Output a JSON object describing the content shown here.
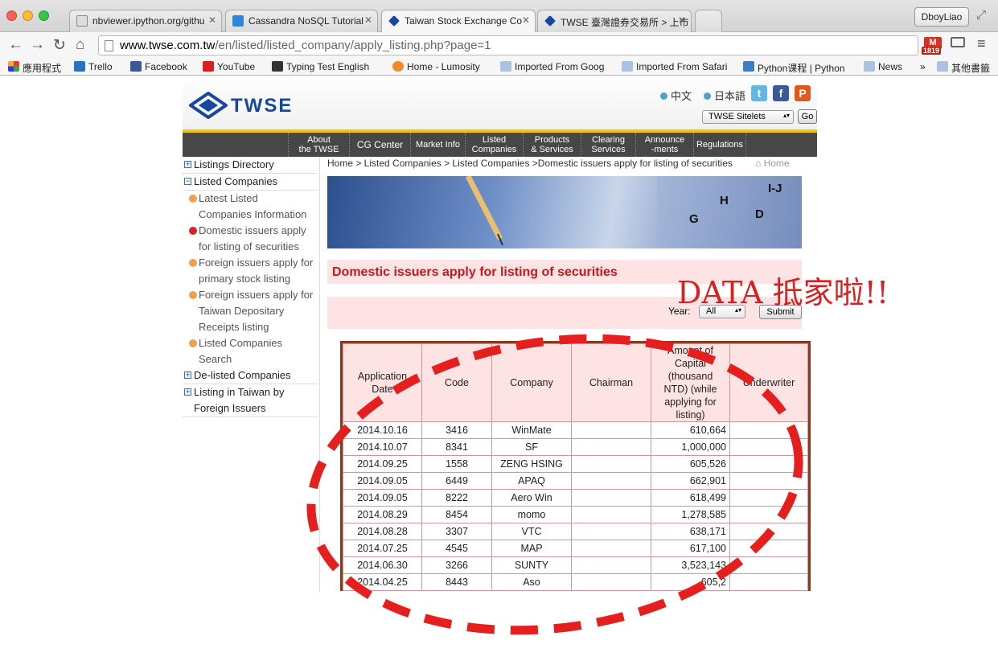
{
  "browser": {
    "tabs": [
      {
        "label": "nbviewer.ipython.org/githu"
      },
      {
        "label": "Cassandra NoSQL Tutorial"
      },
      {
        "label": "Taiwan Stock Exchange Co"
      },
      {
        "label": "TWSE 臺灣證券交易所 > 上市"
      }
    ],
    "user": "DboyLiao",
    "url_host": "www.twse.com.tw",
    "url_path": "/en/listed/listed_company/apply_listing.php?page=1",
    "mail_count": "1819",
    "bookmarks": [
      "應用程式",
      "Trello",
      "Facebook",
      "YouTube",
      "Typing Test English",
      "Home - Lumosity",
      "Imported From Goog",
      "Imported From Safari",
      "Python课程 | Python",
      "News",
      "»",
      "其他書籤"
    ]
  },
  "site": {
    "logo": "TWSE",
    "lang_zh": "中文",
    "lang_ja": "日本語",
    "sitelets": "TWSE Sitelets",
    "go": "Go",
    "menu": [
      "About\nthe TWSE",
      "CG Center",
      "Market Info",
      "Listed\nCompanies",
      "Products\n& Services",
      "Clearing\nServices",
      "Announce\n-ments",
      "Regulations"
    ],
    "leftnav": {
      "listings_directory": "Listings Directory",
      "listed_companies": "Listed Companies",
      "sub": [
        {
          "line1": "Latest Listed",
          "line2": "Companies Information"
        },
        {
          "line1": "Domestic issuers apply",
          "line2": "for listing of securities"
        },
        {
          "line1": "Foreign issuers apply for",
          "line2": "primary stock listing"
        },
        {
          "line1": "Foreign issuers apply for",
          "line2": "Taiwan Depositary",
          "line3": "Receipts listing"
        },
        {
          "line1": "Listed Companies",
          "line2": "Search"
        }
      ],
      "delisted": "De-listed Companies",
      "foreign_line1": "Listing in Taiwan by",
      "foreign_line2": "Foreign Issuers"
    },
    "breadcrumb": "Home > Listed Companies > Listed Companies >Domestic issuers apply for listing of securities",
    "home": "Home",
    "banner_letters": [
      "H",
      "I-J",
      "G",
      "D"
    ],
    "page_title": "Domestic issuers apply for listing of securities",
    "year_label": "Year:",
    "year_value": "All",
    "submit": "Submit",
    "annotation": "DATA 抵家啦!!"
  },
  "table": {
    "headers": [
      "Application\nDate",
      "Code",
      "Company",
      "Chairman",
      "Amount of\nCapital\n(thousand\nNTD) (while\napplying for\nlisting)",
      "Underwriter"
    ],
    "rows": [
      [
        "2014.10.16",
        "3416",
        "WinMate",
        "",
        "610,664",
        ""
      ],
      [
        "2014.10.07",
        "8341",
        "SF",
        "",
        "1,000,000",
        ""
      ],
      [
        "2014.09.25",
        "1558",
        "ZENG HSING",
        "",
        "605,526",
        ""
      ],
      [
        "2014.09.05",
        "6449",
        "APAQ",
        "",
        "662,901",
        ""
      ],
      [
        "2014.09.05",
        "8222",
        "Aero Win",
        "",
        "618,499",
        ""
      ],
      [
        "2014.08.29",
        "8454",
        "momo",
        "",
        "1,278,585",
        ""
      ],
      [
        "2014.08.28",
        "3307",
        "VTC",
        "",
        "638,171",
        ""
      ],
      [
        "2014.07.25",
        "4545",
        "MAP",
        "",
        "617,100",
        ""
      ],
      [
        "2014.06.30",
        "3266",
        "SUNTY",
        "",
        "3,523,143",
        ""
      ],
      [
        "2014.04.25",
        "8443",
        "Aso",
        "",
        "605,2",
        ""
      ]
    ]
  }
}
